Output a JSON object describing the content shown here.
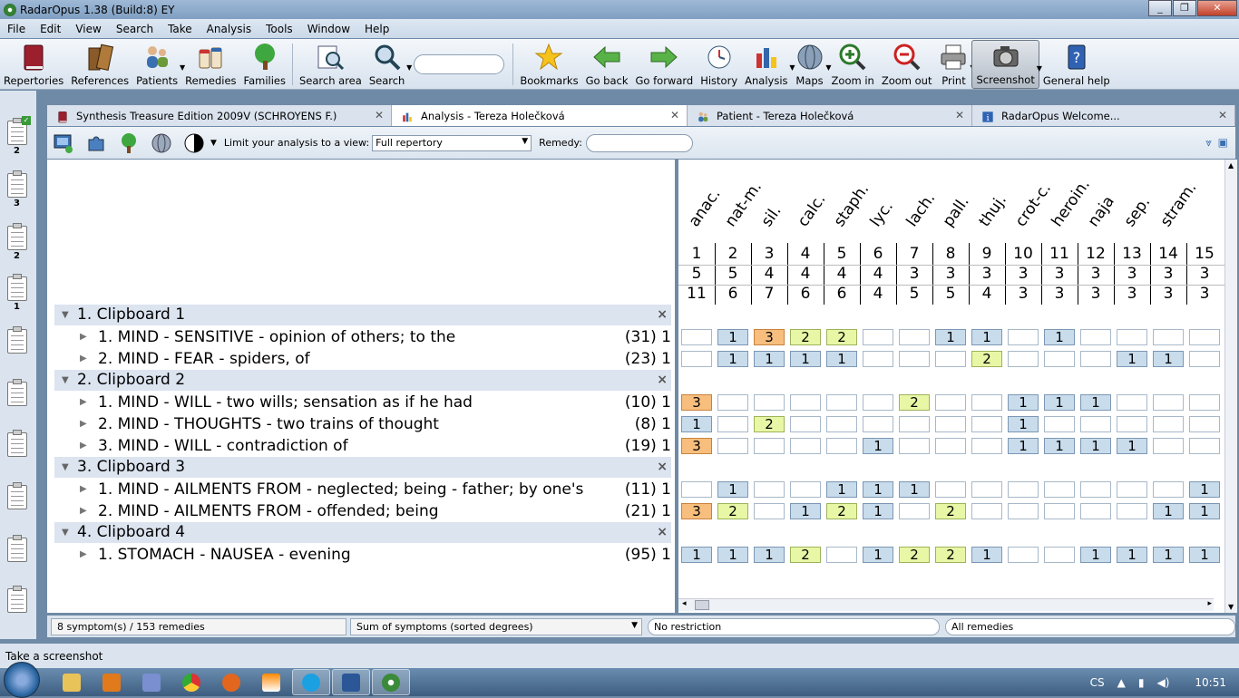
{
  "window": {
    "title": "RadarOpus 1.38 (Build:8)  EY"
  },
  "menu": [
    "File",
    "Edit",
    "View",
    "Search",
    "Take",
    "Analysis",
    "Tools",
    "Window",
    "Help"
  ],
  "toolbar": {
    "left": [
      {
        "label": "Repertories",
        "icon": "book-red-icon"
      },
      {
        "label": "References",
        "icon": "books-brown-icon"
      },
      {
        "label": "Patients",
        "icon": "patients-icon",
        "dropdown": true
      },
      {
        "label": "Remedies",
        "icon": "remedies-jars-icon"
      },
      {
        "label": "Families",
        "icon": "tree-icon"
      },
      {
        "label": "Search area",
        "icon": "search-area-icon"
      },
      {
        "label": "Search",
        "icon": "magnifier-icon",
        "dropdown": true
      }
    ],
    "right": [
      {
        "label": "Bookmarks",
        "icon": "star-icon"
      },
      {
        "label": "Go back",
        "icon": "arrow-left-icon"
      },
      {
        "label": "Go forward",
        "icon": "arrow-right-icon"
      },
      {
        "label": "History",
        "icon": "history-clock-icon"
      },
      {
        "label": "Analysis",
        "icon": "analysis-chart-icon",
        "dropdown": true
      },
      {
        "label": "Maps",
        "icon": "globe-icon",
        "dropdown": true
      },
      {
        "label": "Zoom in",
        "icon": "zoom-in-icon"
      },
      {
        "label": "Zoom out",
        "icon": "zoom-out-icon"
      },
      {
        "label": "Print",
        "icon": "printer-icon",
        "dropdown": true
      },
      {
        "label": "Screenshot",
        "icon": "camera-icon",
        "dropdown": true,
        "selected": true
      },
      {
        "label": "General help",
        "icon": "help-book-icon"
      }
    ]
  },
  "clipboards": [
    "2",
    "3",
    "2",
    "1"
  ],
  "tabs": [
    {
      "label": "Synthesis Treasure Edition 2009V (SCHROYENS F.)",
      "icon": "book-red-icon"
    },
    {
      "label": "Analysis - Tereza Holečková",
      "icon": "analysis-chart-icon",
      "active": true
    },
    {
      "label": "Patient - Tereza Holečková",
      "icon": "patients-icon"
    },
    {
      "label": "RadarOpus Welcome...",
      "icon": "info-icon"
    }
  ],
  "filter": {
    "label": "Limit your analysis to a view:",
    "view": "Full repertory",
    "remedy_label": "Remedy:"
  },
  "groups": [
    {
      "title": "1. Clipboard 1",
      "symptoms": [
        {
          "text": "1. MIND - SENSITIVE - opinion of others; to the",
          "count": "(31) 1"
        },
        {
          "text": "2. MIND - FEAR - spiders, of",
          "count": "(23) 1"
        }
      ]
    },
    {
      "title": "2. Clipboard 2",
      "symptoms": [
        {
          "text": "1. MIND - WILL - two wills; sensation as if he had",
          "count": "(10) 1"
        },
        {
          "text": "2. MIND - THOUGHTS - two trains of thought",
          "count": "(8) 1"
        },
        {
          "text": "3. MIND - WILL - contradiction of",
          "count": "(19) 1"
        }
      ]
    },
    {
      "title": "3. Clipboard 3",
      "symptoms": [
        {
          "text": "1. MIND - AILMENTS FROM - neglected; being - father; by one's",
          "count": "(11) 1"
        },
        {
          "text": "2. MIND - AILMENTS FROM - offended; being",
          "count": "(21) 1"
        }
      ]
    },
    {
      "title": "4. Clipboard 4",
      "symptoms": [
        {
          "text": "1. STOMACH - NAUSEA - evening",
          "count": "(95) 1"
        }
      ]
    }
  ],
  "remedies": [
    "anac.",
    "nat-m.",
    "sil.",
    "calc.",
    "staph.",
    "lyc.",
    "lach.",
    "pall.",
    "thuj.",
    "crot-c.",
    "heroin.",
    "naja",
    "sep.",
    "stram."
  ],
  "ranks": [
    "1",
    "2",
    "3",
    "4",
    "5",
    "6",
    "7",
    "8",
    "9",
    "10",
    "11",
    "12",
    "13",
    "14",
    "15"
  ],
  "symptom_counts": [
    "5",
    "5",
    "4",
    "4",
    "4",
    "4",
    "3",
    "3",
    "3",
    "3",
    "3",
    "3",
    "3",
    "3",
    "3"
  ],
  "degree_sums": [
    "11",
    "6",
    "7",
    "6",
    "6",
    "4",
    "5",
    "5",
    "4",
    "3",
    "3",
    "3",
    "3",
    "3",
    "3"
  ],
  "grid": [
    [
      "",
      "1",
      "3",
      "2",
      "2",
      "",
      "",
      "1",
      "1",
      "",
      "1",
      "",
      "",
      "",
      ""
    ],
    [
      "",
      "1",
      "1",
      "1",
      "1",
      "",
      "",
      "",
      "2",
      "",
      "",
      "",
      "1",
      "1",
      ""
    ],
    [
      "3",
      "",
      "",
      "",
      "",
      "",
      "2",
      "",
      "",
      "1",
      "1",
      "1",
      "",
      "",
      ""
    ],
    [
      "1",
      "",
      "2",
      "",
      "",
      "",
      "",
      "",
      "",
      "1",
      "",
      "",
      "",
      "",
      ""
    ],
    [
      "3",
      "",
      "",
      "",
      "",
      "1",
      "",
      "",
      "",
      "1",
      "1",
      "1",
      "1",
      "",
      ""
    ],
    [
      "",
      "1",
      "",
      "",
      "1",
      "1",
      "1",
      "",
      "",
      "",
      "",
      "",
      "",
      "",
      "1"
    ],
    [
      "3",
      "2",
      "",
      "1",
      "2",
      "1",
      "",
      "2",
      "",
      "",
      "",
      "",
      "",
      "1",
      "1"
    ],
    [
      "1",
      "1",
      "1",
      "2",
      "",
      "1",
      "2",
      "2",
      "1",
      "",
      "",
      "1",
      "1",
      "1",
      "1"
    ]
  ],
  "status": {
    "count": "8 symptom(s) / 153 remedies",
    "sort": "Sum of symptoms (sorted degrees)",
    "restriction": "No restriction",
    "remedies": "All remedies"
  },
  "hint": "Take a screenshot",
  "tray": {
    "lang": "CS",
    "time": "10:51"
  }
}
